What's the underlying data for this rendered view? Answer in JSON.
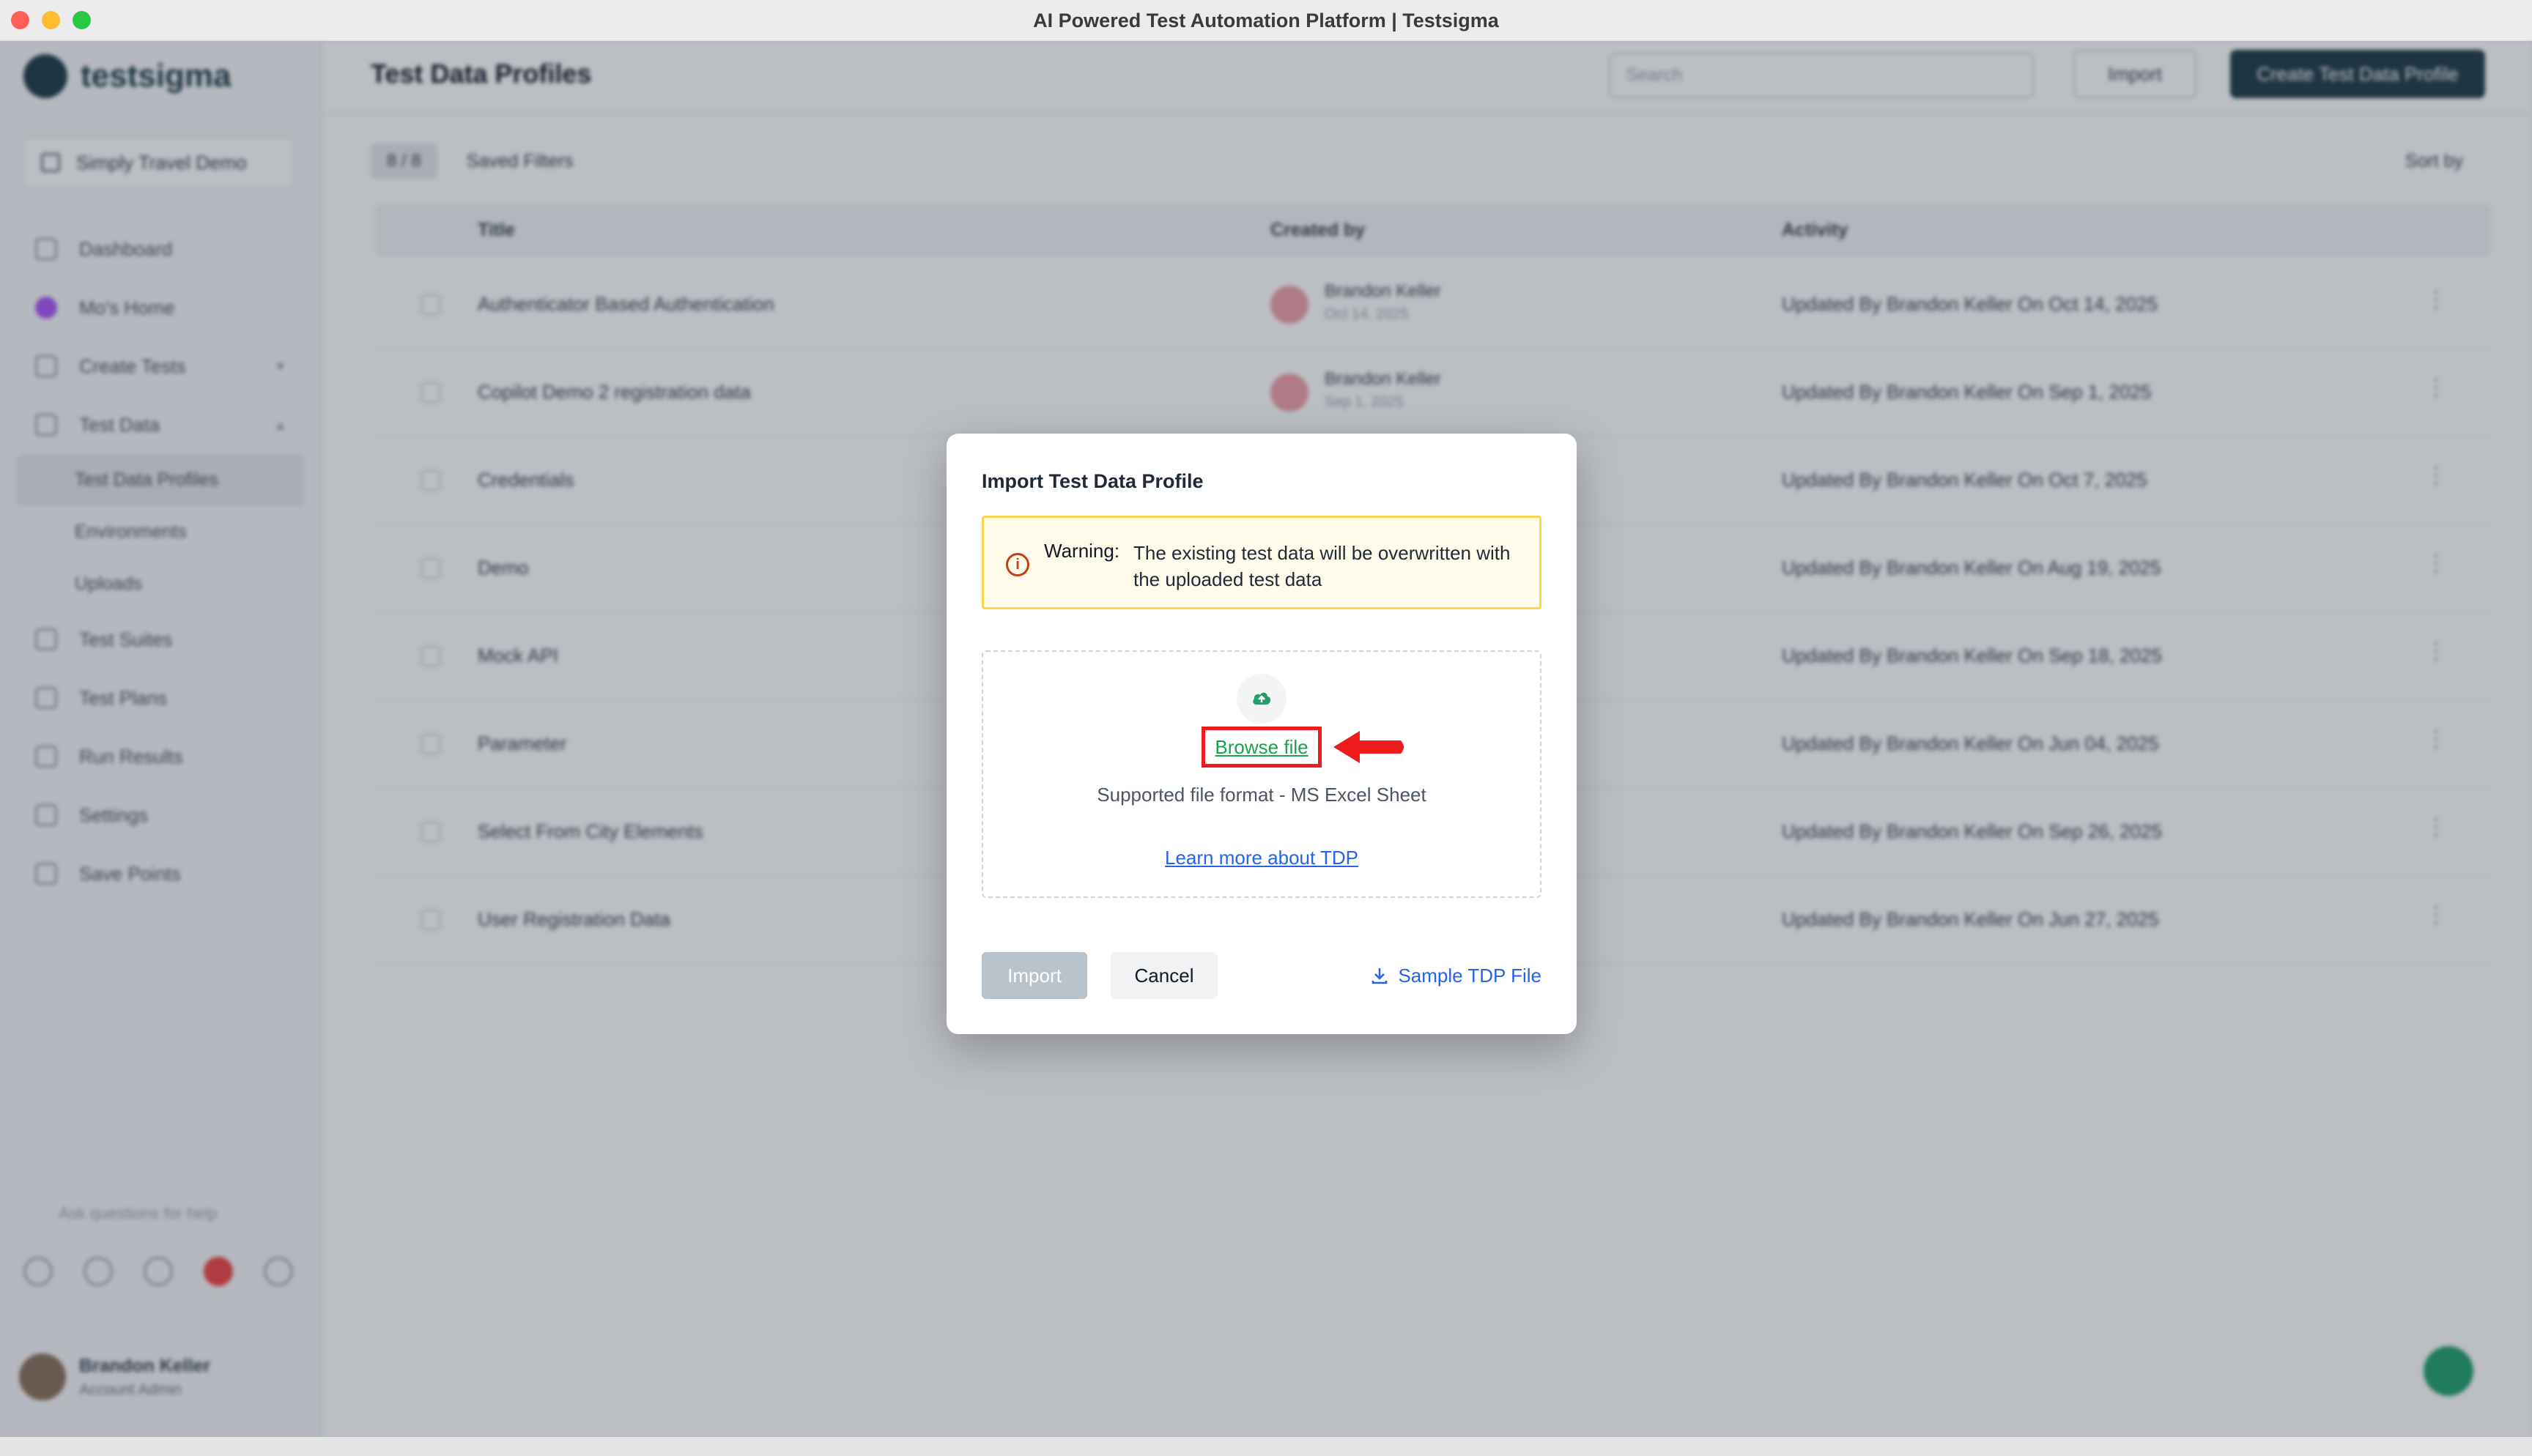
{
  "window": {
    "title": "AI Powered Test Automation Platform | Testsigma"
  },
  "sidebar": {
    "logo_text": "testsigma",
    "workspace": "Simply Travel Demo",
    "items": [
      {
        "label": "Dashboard",
        "icon": "home-icon"
      },
      {
        "label": "Mo's Home",
        "icon": "user-circle-icon"
      },
      {
        "label": "Create Tests",
        "icon": "pencil-icon"
      },
      {
        "label": "Test Data",
        "icon": "database-icon"
      }
    ],
    "sub_items": [
      "Test Data Profiles",
      "Environments",
      "Uploads"
    ],
    "items_after": [
      {
        "label": "Test Suites",
        "icon": "suite-icon"
      },
      {
        "label": "Test Plans",
        "icon": "plan-icon"
      },
      {
        "label": "Run Results",
        "icon": "results-icon"
      },
      {
        "label": "Settings",
        "icon": "gear-icon"
      },
      {
        "label": "Save Points",
        "icon": "savepoint-icon"
      }
    ],
    "bottom_label": "Ask questions for help",
    "user": {
      "name": "Brandon Keller",
      "role": "Account Admin"
    }
  },
  "main": {
    "title": "Test Data Profiles",
    "search_placeholder": "Search",
    "import_label": "Import",
    "create_label": "Create Test Data Profile",
    "count": "8 / 8",
    "saved_filters": "Saved Filters",
    "sort_by": "Sort by",
    "columns": [
      "Title",
      "Created by",
      "Activity"
    ],
    "rows": [
      {
        "title": "Authenticator Based Authentication",
        "creator": "Brandon Keller",
        "created": "Oct 14, 2025",
        "activity": "Updated By Brandon Keller On Oct 14, 2025"
      },
      {
        "title": "Copilot Demo 2 registration data",
        "creator": "Brandon Keller",
        "created": "Sep 1, 2025",
        "activity": "Updated By Brandon Keller On Sep 1, 2025"
      },
      {
        "title": "Credentials",
        "creator": "",
        "created": "",
        "activity": "Updated By Brandon Keller On Oct 7, 2025"
      },
      {
        "title": "Demo",
        "creator": "",
        "created": "",
        "activity": "Updated By Brandon Keller On Aug 19, 2025"
      },
      {
        "title": "Mock API",
        "creator": "",
        "created": "",
        "activity": "Updated By Brandon Keller On Sep 18, 2025"
      },
      {
        "title": "Parameter",
        "creator": "",
        "created": "",
        "activity": "Updated By Brandon Keller On Jun 04, 2025"
      },
      {
        "title": "Select From City Elements",
        "creator": "",
        "created": "",
        "activity": "Updated By Brandon Keller On Sep 26, 2025"
      },
      {
        "title": "User Registration Data",
        "creator": "",
        "created": "",
        "activity": "Updated By Brandon Keller On Jun 27, 2025"
      }
    ]
  },
  "modal": {
    "title": "Import Test Data Profile",
    "warning_label": "Warning:",
    "warning_text": "The existing test data will be overwritten with the uploaded test data",
    "browse_label": "Browse file",
    "supported_text": "Supported file format - MS Excel Sheet",
    "learn_more": "Learn more about TDP",
    "import_label": "Import",
    "cancel_label": "Cancel",
    "sample_label": "Sample TDP File"
  },
  "colors": {
    "accent_green": "#16a34a",
    "link_blue": "#2563eb",
    "highlight_red": "#ee1c1c",
    "warning_bg": "#fffbeb",
    "warning_border": "#fcd34d",
    "disabled_button": "#b9c3cc"
  }
}
